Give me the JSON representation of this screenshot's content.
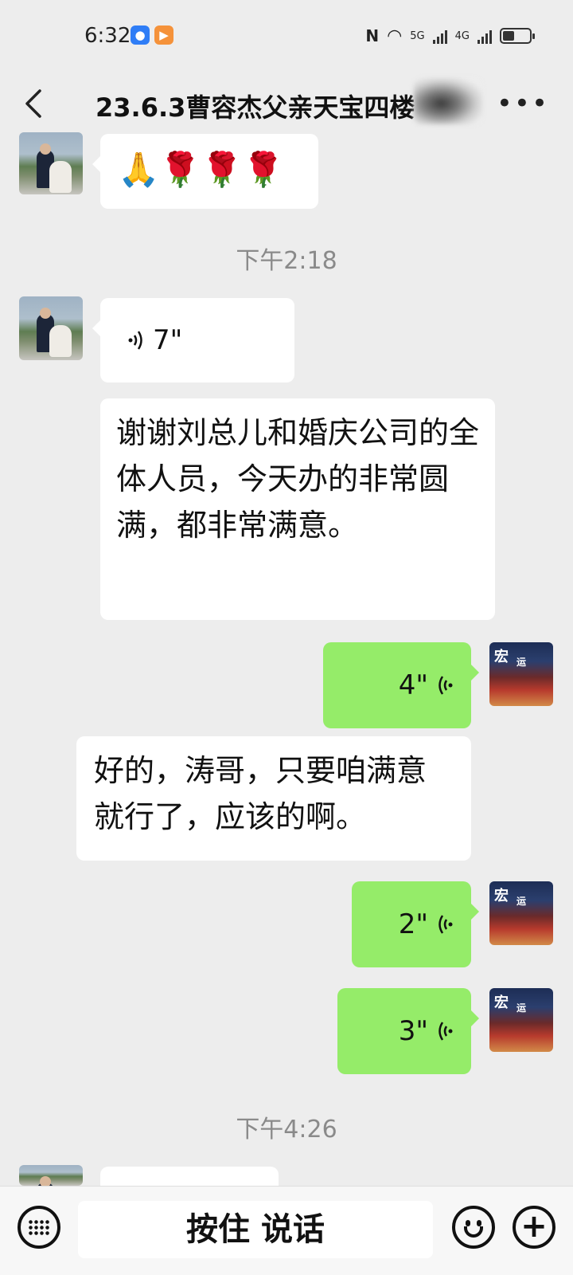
{
  "status_bar": {
    "time": "6:32",
    "signal1_label": "5G",
    "signal2_label": "4G"
  },
  "header": {
    "title": "23.6.3曹容杰父亲天宝四楼"
  },
  "messages": {
    "m1_emoji": "🙏🌹🌹🌹",
    "ts1": "下午2:18",
    "m2_voice": "7\"",
    "m3_text": "谢谢刘总儿和婚庆公司的全体人员，今天办的非常圆满，都非常满意。",
    "m4_voice": "4\"",
    "m5_text": "好的，涛哥，只要咱满意就行了，应该的啊。",
    "m6_voice": "2\"",
    "m7_voice": "3\"",
    "ts2": "下午4:26"
  },
  "avatar_right_sign": "宏",
  "avatar_right_sign2": "运",
  "bottom": {
    "talk_label": "按住 说话",
    "plus": "+"
  },
  "colors": {
    "background": "#ededed",
    "my_bubble": "#95ec69",
    "their_bubble": "#ffffff"
  },
  "icons": [
    "back-icon",
    "more-icon",
    "voice-icon",
    "keyboard-icon",
    "emoji-icon",
    "plus-icon"
  ]
}
